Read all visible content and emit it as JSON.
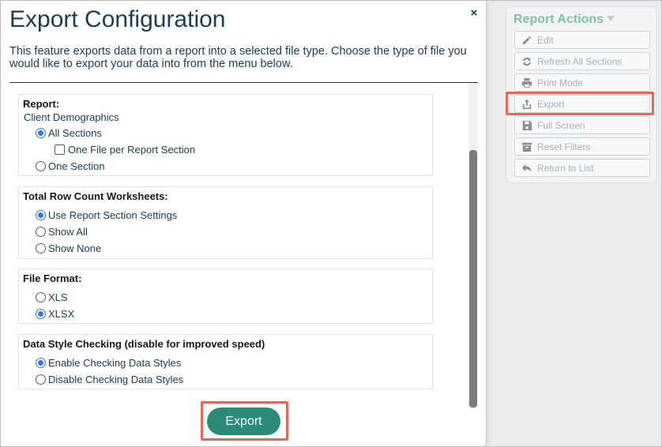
{
  "modal": {
    "title": "Export Configuration",
    "close_glyph": "×",
    "description": "This feature exports data from a report into a selected file type. Choose the type of file you would like to export your data into from the menu below.",
    "export_button": "Export",
    "sections": {
      "report": {
        "heading": "Report:",
        "report_name": "Client Demographics",
        "options": [
          {
            "label": "All Sections",
            "selected": true
          },
          {
            "label": "One File per Report Section",
            "checked": false
          },
          {
            "label": "One Section",
            "selected": false
          }
        ]
      },
      "row_count": {
        "heading": "Total Row Count Worksheets:",
        "options": [
          {
            "label": "Use Report Section Settings",
            "selected": true
          },
          {
            "label": "Show All",
            "selected": false
          },
          {
            "label": "Show None",
            "selected": false
          }
        ]
      },
      "file_format": {
        "heading": "File Format:",
        "options": [
          {
            "label": "XLS",
            "selected": false
          },
          {
            "label": "XLSX",
            "selected": true
          }
        ]
      },
      "style_checking": {
        "heading": "Data Style Checking (disable for improved speed)",
        "options": [
          {
            "label": "Enable Checking Data Styles",
            "selected": true
          },
          {
            "label": "Disable Checking Data Styles",
            "selected": false
          }
        ]
      }
    }
  },
  "report_actions": {
    "title": "Report Actions",
    "items": [
      {
        "label": "Edit",
        "icon": "pencil-icon"
      },
      {
        "label": "Refresh All Sections",
        "icon": "refresh-icon"
      },
      {
        "label": "Print Mode",
        "icon": "printer-icon"
      },
      {
        "label": "Export",
        "icon": "export-icon"
      },
      {
        "label": "Full Screen",
        "icon": "full-screen-icon"
      },
      {
        "label": "Reset Filters",
        "icon": "archive-icon"
      },
      {
        "label": "Return to List",
        "icon": "return-arrow-icon"
      }
    ]
  },
  "colors": {
    "accent_green": "#2b8a78",
    "actions_title": "#7fbfac",
    "highlight": "#e5675a",
    "radio_selected": "#2f76e0"
  }
}
